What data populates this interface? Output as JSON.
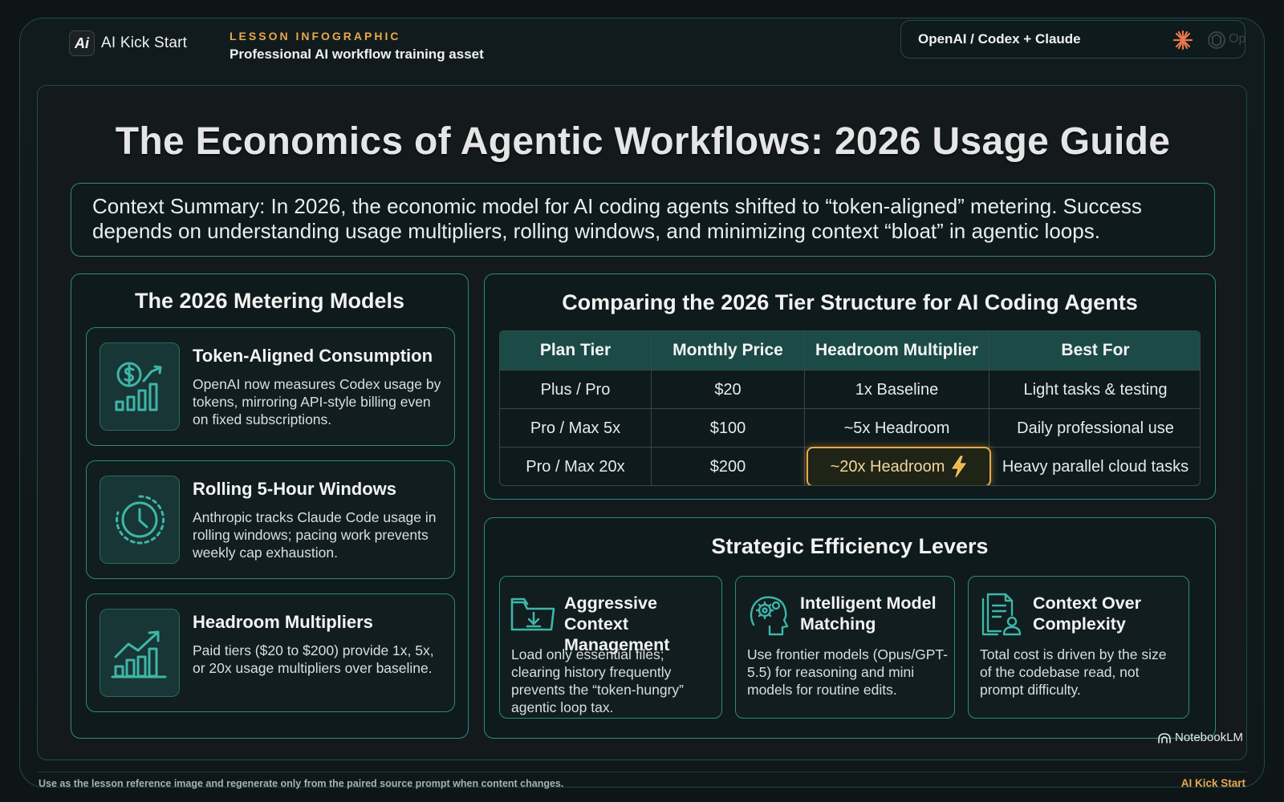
{
  "header": {
    "brand_mark": "Ai",
    "brand_name": "AI Kick Start",
    "lesson_tag": "LESSON INFOGRAPHIC",
    "lesson_subtitle": "Professional AI workflow training asset",
    "providers": "OpenAI / Codex + Claude",
    "provider_ghost": "OpenAI"
  },
  "main": {
    "title": "The Economics of Agentic Workflows: 2026 Usage Guide",
    "summary": "Context Summary: In 2026, the economic model for AI coding agents shifted to “token-aligned” metering. Success depends on understanding usage multipliers, rolling windows, and minimizing context “bloat” in agentic loops."
  },
  "metering": {
    "title": "The 2026 Metering Models",
    "items": [
      {
        "icon": "dollar-growth-icon",
        "title": "Token-Aligned Consumption",
        "description": "OpenAI now measures Codex usage by tokens, mirroring API-style billing even on fixed subscriptions."
      },
      {
        "icon": "clock-icon",
        "title": "Rolling 5-Hour Windows",
        "description": "Anthropic tracks Claude Code usage in rolling windows; pacing work prevents weekly cap exhaustion."
      },
      {
        "icon": "bar-growth-icon",
        "title": "Headroom Multipliers",
        "description": "Paid tiers ($20 to $200) provide 1x, 5x, or 20x usage multipliers over baseline."
      }
    ]
  },
  "tiers": {
    "title": "Comparing the 2026 Tier Structure for AI Coding Agents",
    "columns": [
      "Plan Tier",
      "Monthly Price",
      "Headroom Multiplier",
      "Best For"
    ],
    "rows": [
      [
        "Plus / Pro",
        "$20",
        "1x Baseline",
        "Light tasks & testing"
      ],
      [
        "Pro / Max 5x",
        "$100",
        "~5x Headroom",
        "Daily professional use"
      ],
      [
        "Pro / Max 20x",
        "$200",
        "~20x Headroom",
        "Heavy parallel cloud tasks"
      ]
    ],
    "highlight_color": "#e9a94b"
  },
  "levers": {
    "title": "Strategic Efficiency Levers",
    "items": [
      {
        "icon": "folder-download-icon",
        "title_line1": "Aggressive Context",
        "title_line2": "Management",
        "description": "Load only essential files; clearing history frequently prevents the “token-hungry” agentic loop tax."
      },
      {
        "icon": "brain-gear-icon",
        "title_line1": "Intelligent Model",
        "title_line2": "Matching",
        "description": "Use frontier models (Opus/GPT-5.5) for reasoning and mini models for routine edits."
      },
      {
        "icon": "document-user-icon",
        "title_line1": "Context Over",
        "title_line2": "Complexity",
        "description": "Total cost is driven by the size of the codebase read, not prompt difficulty."
      }
    ]
  },
  "footer": {
    "notebook_label": "NotebookLM",
    "note": "Use as the lesson reference image and regenerate only from the paired source prompt when content changes.",
    "brand": "AI Kick Start"
  },
  "colors": {
    "accent_teal": "#2c8a82",
    "accent_gold": "#e9a94b",
    "background": "#0d1517"
  }
}
